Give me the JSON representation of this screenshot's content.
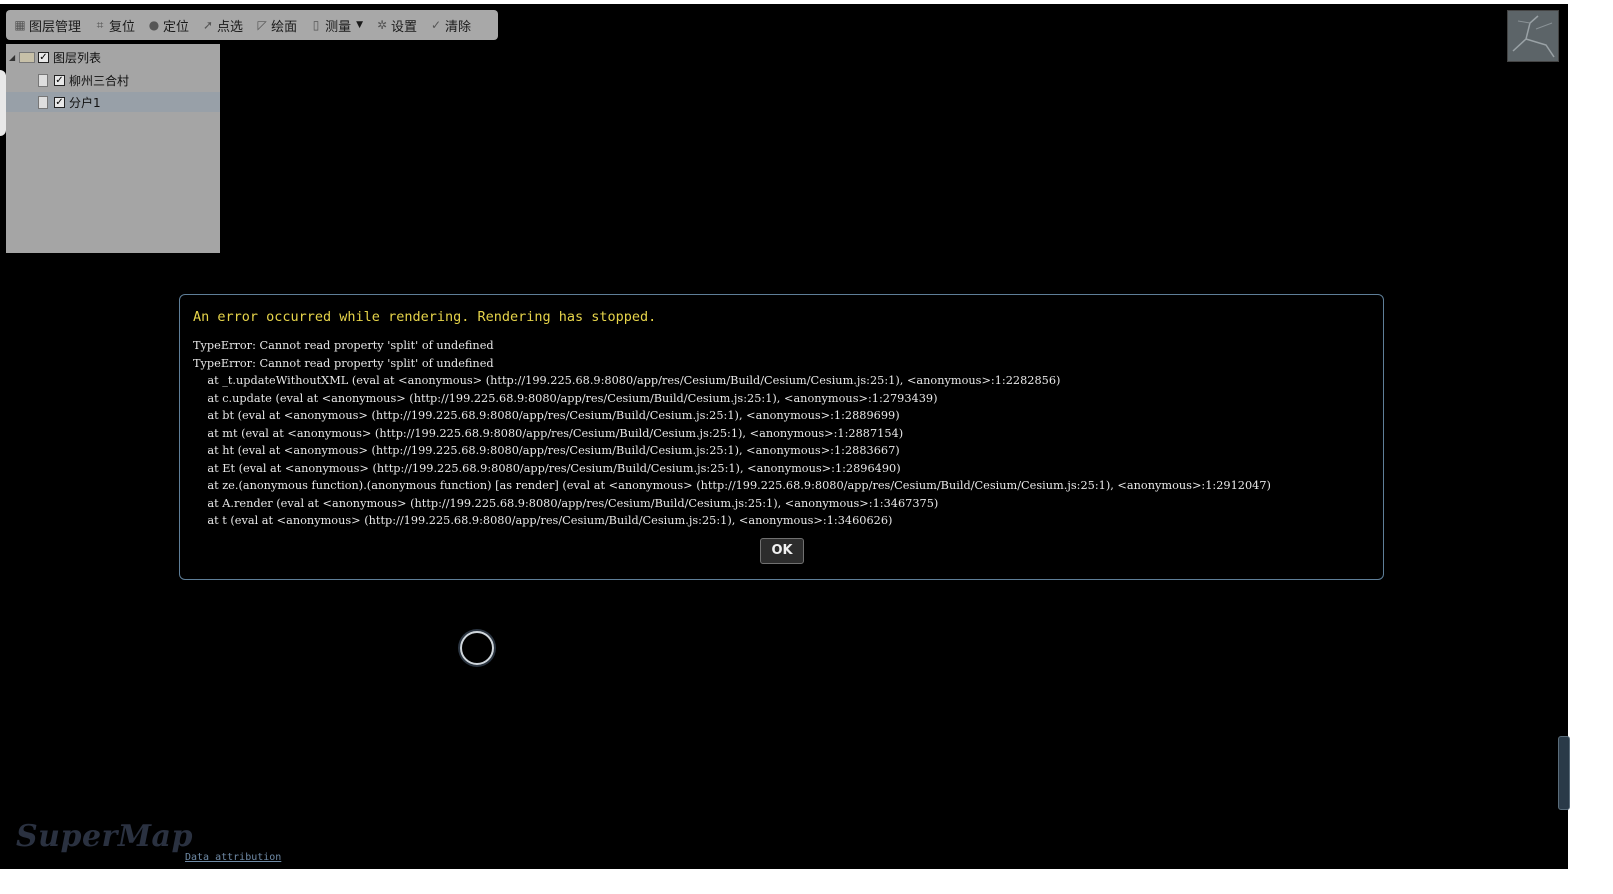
{
  "toolbar": {
    "items": [
      {
        "label": "图层管理",
        "icon": "layers-icon"
      },
      {
        "label": "复位",
        "icon": "reset-icon"
      },
      {
        "label": "定位",
        "icon": "location-pin-icon"
      },
      {
        "label": "点选",
        "icon": "cursor-select-icon"
      },
      {
        "label": "绘面",
        "icon": "draw-polygon-icon"
      },
      {
        "label": "测量",
        "icon": "ruler-icon",
        "has_dropdown": true
      },
      {
        "label": "设置",
        "icon": "gear-icon"
      },
      {
        "label": "清除",
        "icon": "brush-icon"
      }
    ]
  },
  "layer_tree": {
    "root": {
      "label": "图层列表",
      "checked": true,
      "expanded": true
    },
    "children": [
      {
        "label": "柳州三合村",
        "checked": true,
        "selected": false
      },
      {
        "label": "分户1",
        "checked": true,
        "selected": true
      }
    ]
  },
  "error_dialog": {
    "title": "An error occurred while rendering. Rendering has stopped.",
    "message": "TypeError: Cannot read property 'split' of undefined\nTypeError: Cannot read property 'split' of undefined\n    at _t.updateWithoutXML (eval at <anonymous> (http://199.225.68.9:8080/app/res/Cesium/Build/Cesium/Cesium.js:25:1), <anonymous>:1:2282856)\n    at c.update (eval at <anonymous> (http://199.225.68.9:8080/app/res/Cesium/Build/Cesium.js:25:1), <anonymous>:1:2793439)\n    at bt (eval at <anonymous> (http://199.225.68.9:8080/app/res/Cesium/Build/Cesium.js:25:1), <anonymous>:1:2889699)\n    at mt (eval at <anonymous> (http://199.225.68.9:8080/app/res/Cesium/Build/Cesium.js:25:1), <anonymous>:1:2887154)\n    at ht (eval at <anonymous> (http://199.225.68.9:8080/app/res/Cesium/Build/Cesium.js:25:1), <anonymous>:1:2883667)\n    at Et (eval at <anonymous> (http://199.225.68.9:8080/app/res/Cesium/Build/Cesium.js:25:1), <anonymous>:1:2896490)\n    at ze.(anonymous function).(anonymous function) [as render] (eval at <anonymous> (http://199.225.68.9:8080/app/res/Cesium/Build/Cesium/Cesium.js:25:1), <anonymous>:1:2912047)\n    at A.render (eval at <anonymous> (http://199.225.68.9:8080/app/res/Cesium/Build/Cesium.js:25:1), <anonymous>:1:3467375)\n    at t (eval at <anonymous> (http://199.225.68.9:8080/app/res/Cesium/Build/Cesium.js:25:1), <anonymous>:1:3460626)",
    "ok_label": "OK"
  },
  "footer": {
    "logo_text": "SuperMap",
    "attribution_label": "Data attribution"
  },
  "colors": {
    "viewer_bg": "#000000",
    "error_title": "#e6d44a",
    "dialog_border": "#5e7e98",
    "panel_bg": "#a5a5a5"
  }
}
